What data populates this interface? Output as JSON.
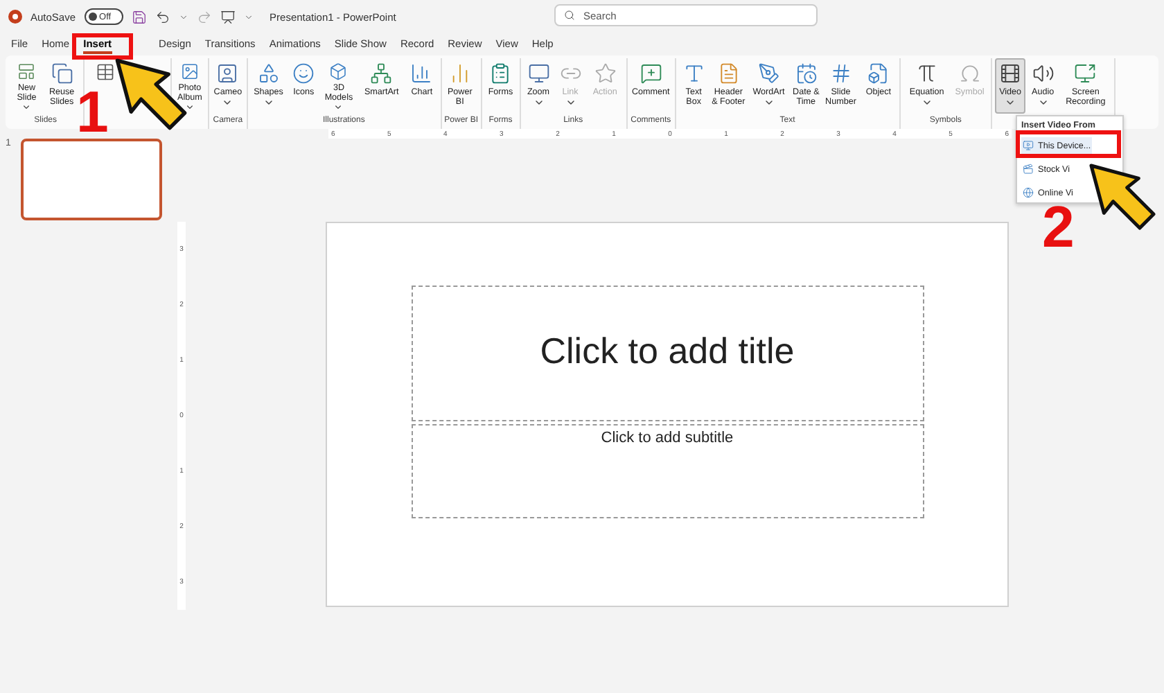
{
  "title_bar": {
    "autosave_label": "AutoSave",
    "autosave": {
      "on": false,
      "label": "Off"
    },
    "title": "Presentation1 - PowerPoint",
    "search": {
      "placeholder": "Search"
    }
  },
  "tabs": [
    {
      "label": "File",
      "selected": false
    },
    {
      "label": "Home",
      "selected": false
    },
    {
      "label": "Insert",
      "selected": true
    },
    {
      "label": "Design",
      "selected": false
    },
    {
      "label": "Transitions",
      "selected": false
    },
    {
      "label": "Animations",
      "selected": false
    },
    {
      "label": "Slide Show",
      "selected": false
    },
    {
      "label": "Record",
      "selected": false
    },
    {
      "label": "Review",
      "selected": false
    },
    {
      "label": "View",
      "selected": false
    },
    {
      "label": "Help",
      "selected": false
    }
  ],
  "ribbon": [
    {
      "label": "Slides",
      "buttons": [
        {
          "label": "New Slide",
          "dropdown": true,
          "disabled": false
        },
        {
          "label": "Reuse Slides",
          "dropdown": false,
          "disabled": false
        }
      ]
    },
    {
      "buttons": [
        {
          "disabled": false
        }
      ]
    },
    {
      "buttons": [
        {
          "label": "Photo Album",
          "dropdown": true,
          "disabled": false
        }
      ]
    },
    {
      "label": "Camera",
      "buttons": [
        {
          "label": "Cameo",
          "dropdown": true,
          "disabled": false
        }
      ]
    },
    {
      "label": "Illustrations",
      "buttons": [
        {
          "label": "Shapes",
          "dropdown": true,
          "disabled": false
        },
        {
          "label": "Icons",
          "dropdown": false,
          "disabled": false
        },
        {
          "label": "3D Models",
          "dropdown": true,
          "disabled": false
        },
        {
          "label": "SmartArt",
          "dropdown": false,
          "disabled": false
        },
        {
          "label": "Chart",
          "dropdown": false,
          "disabled": false
        }
      ]
    },
    {
      "label": "Power BI",
      "buttons": [
        {
          "label": "Power BI",
          "dropdown": false,
          "disabled": false
        }
      ]
    },
    {
      "label": "Forms",
      "buttons": [
        {
          "label": "Forms",
          "dropdown": false,
          "disabled": false
        }
      ]
    },
    {
      "label": "Links",
      "buttons": [
        {
          "label": "Zoom",
          "dropdown": true,
          "disabled": false
        },
        {
          "label": "Link",
          "dropdown": true,
          "disabled": true
        },
        {
          "label": "Action",
          "dropdown": false,
          "disabled": true
        }
      ]
    },
    {
      "label": "Comments",
      "buttons": [
        {
          "label": "Comment",
          "dropdown": false,
          "disabled": false
        }
      ]
    },
    {
      "label": "Text",
      "buttons": [
        {
          "label": "Text Box",
          "dropdown": false,
          "disabled": false
        },
        {
          "label": "Header & Footer",
          "dropdown": false,
          "disabled": false
        },
        {
          "label": "WordArt",
          "dropdown": true,
          "disabled": false
        },
        {
          "label": "Date & Time",
          "dropdown": false,
          "disabled": false
        },
        {
          "label": "Slide Number",
          "dropdown": false,
          "disabled": false
        },
        {
          "label": "Object",
          "dropdown": false,
          "disabled": false
        }
      ]
    },
    {
      "label": "Symbols",
      "buttons": [
        {
          "label": "Equation",
          "dropdown": true,
          "disabled": false
        },
        {
          "label": "Symbol",
          "dropdown": false,
          "disabled": true
        }
      ]
    },
    {
      "buttons": [
        {
          "label": "Video",
          "dropdown": true,
          "disabled": false,
          "expanded": true
        },
        {
          "label": "Audio",
          "dropdown": true,
          "disabled": false,
          "expanded": false
        },
        {
          "label": "Screen Recording",
          "dropdown": false,
          "disabled": false,
          "expanded": false
        }
      ]
    }
  ],
  "video_menu": {
    "header": "Insert Video From",
    "items": [
      {
        "label": "This Device...",
        "selected": true
      },
      {
        "label": "Stock Vi",
        "selected": false
      },
      {
        "label": "Online Vi",
        "selected": false
      }
    ]
  },
  "ruler": {
    "horizontal": [
      "6",
      "5",
      "4",
      "3",
      "2",
      "1",
      "0",
      "1",
      "2",
      "3",
      "4",
      "5",
      "6"
    ],
    "vertical": [
      "3",
      "2",
      "1",
      "0",
      "1",
      "2",
      "3"
    ]
  },
  "thumbnails": [
    {
      "number": "1",
      "selected": true
    }
  ],
  "slide": {
    "title_placeholder": "Click to add title",
    "subtitle_placeholder": "Click to add subtitle"
  },
  "annotations": [
    {
      "number": "1"
    },
    {
      "number": "2"
    }
  ]
}
